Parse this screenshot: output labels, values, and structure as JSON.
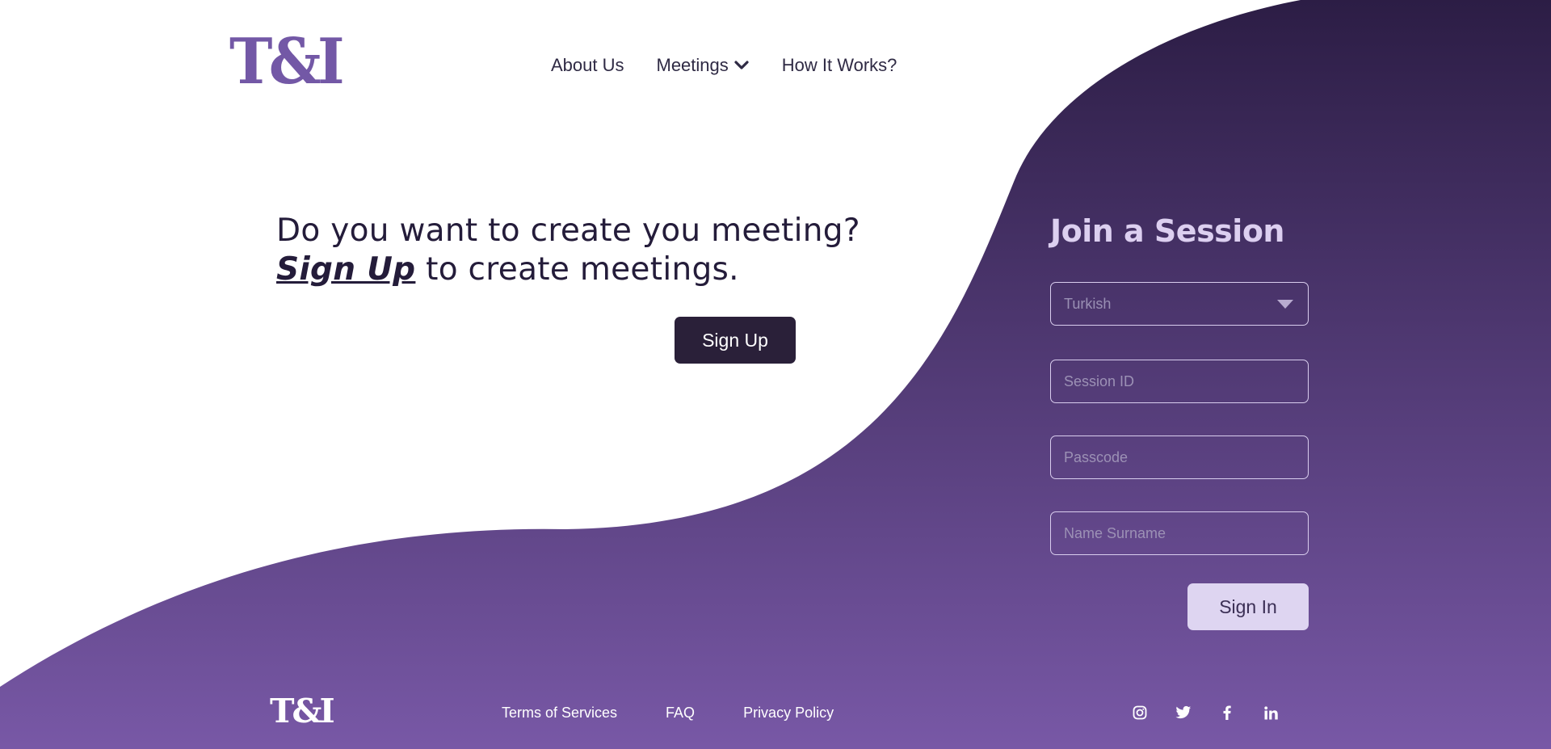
{
  "logo": {
    "text": "T&I"
  },
  "nav": {
    "items": [
      {
        "label": "About Us"
      },
      {
        "label": "Meetings"
      },
      {
        "label": "How It Works?"
      }
    ]
  },
  "hero": {
    "line1": "Do you want to create you meeting?",
    "line2_link": "Sign Up",
    "line2_rest": " to create meetings.",
    "signup_button": "Sign Up"
  },
  "join": {
    "title": "Join a Session",
    "language_value": "Turkish",
    "session_placeholder": "Session ID",
    "passcode_placeholder": "Passcode",
    "name_placeholder": "Name Surname",
    "signin_button": "Sign In"
  },
  "footer": {
    "logo": "T&I",
    "links": [
      {
        "label": "Terms of Services"
      },
      {
        "label": "FAQ"
      },
      {
        "label": "Privacy Policy"
      }
    ],
    "socials": [
      "instagram-icon",
      "twitter-icon",
      "facebook-icon",
      "linkedin-icon"
    ]
  },
  "colors": {
    "brand": "#7358a6",
    "wave_top": "#2c1d45",
    "wave_bottom": "#7858a6",
    "dark_button": "#2a2039",
    "light_button": "#ded5f1"
  }
}
